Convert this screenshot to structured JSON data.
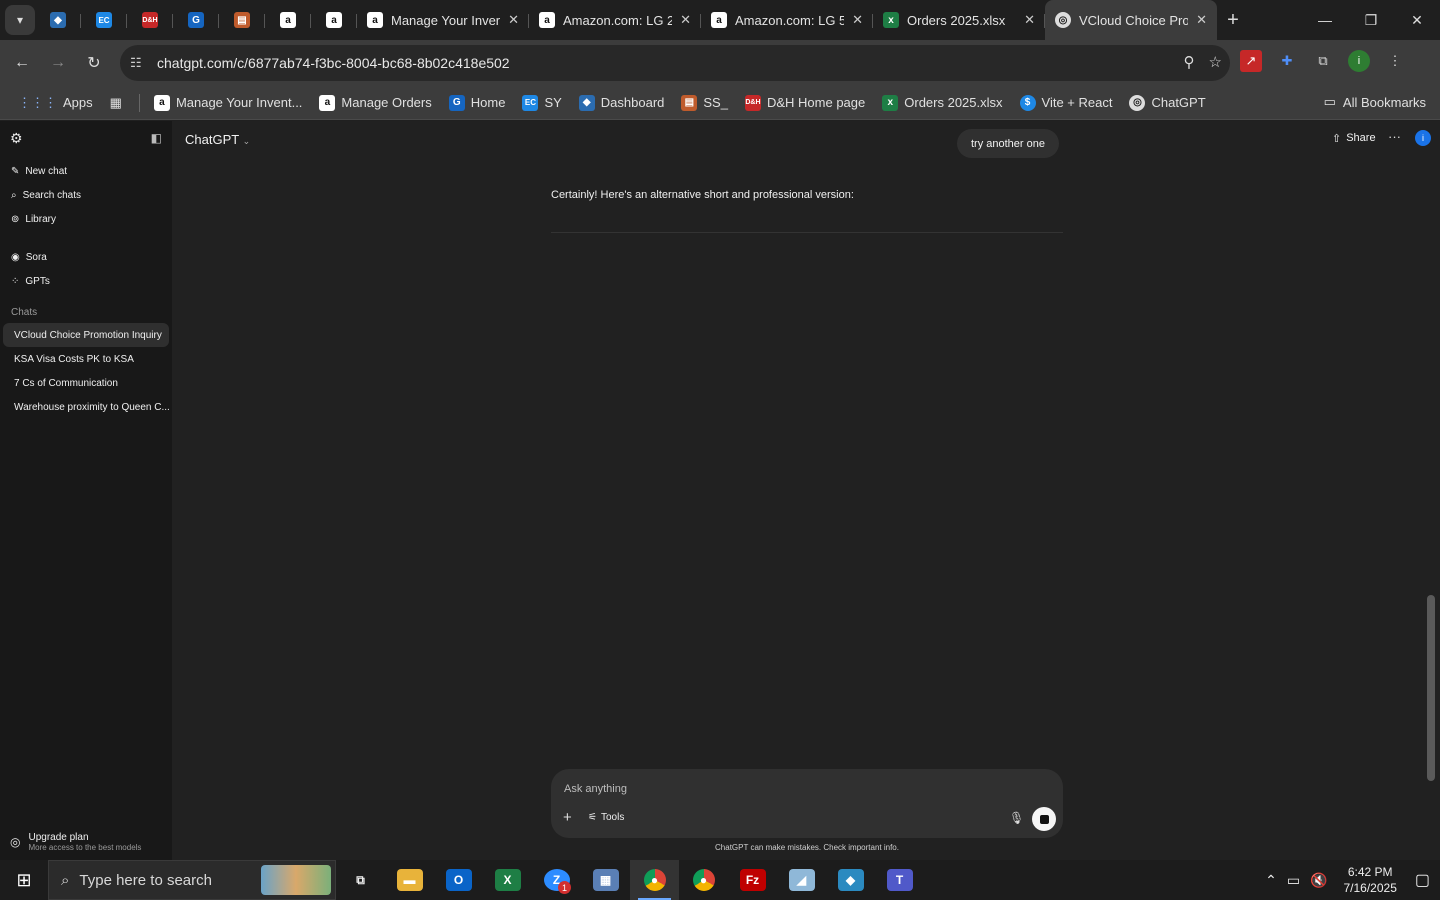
{
  "browser": {
    "tabs": [
      {
        "title": "Manage Your Inver",
        "favicon": "amazon-icon"
      },
      {
        "title": "Amazon.com: LG 2",
        "favicon": "amazon-icon"
      },
      {
        "title": "Amazon.com: LG 5",
        "favicon": "amazon-icon"
      },
      {
        "title": "Orders 2025.xlsx",
        "favicon": "excel-icon"
      },
      {
        "title": "VCloud Choice Pro",
        "favicon": "chatgpt-icon",
        "active": true
      }
    ],
    "url": "chatgpt.com/c/6877ab74-f3bc-8004-bc68-8b02c418e502",
    "bookmarks": {
      "apps_label": "Apps",
      "items": [
        "Manage Your Invent...",
        "Manage Orders",
        "Home",
        "SY",
        "Dashboard",
        "SS_",
        "D&H Home page",
        "Orders 2025.xlsx",
        "Vite + React",
        "ChatGPT"
      ],
      "all_bookmarks": "All Bookmarks"
    },
    "profile_initial": "i"
  },
  "sidebar": {
    "nav": [
      "New chat",
      "Search chats",
      "Library"
    ],
    "nav2": [
      "Sora",
      "GPTs"
    ],
    "chats_label": "Chats",
    "chats": [
      "VCloud Choice Promotion Inquiry",
      "KSA Visa Costs PK to KSA",
      "7 Cs of Communication",
      "Warehouse proximity to Queen C..."
    ],
    "upgrade_title": "Upgrade plan",
    "upgrade_sub": "More access to the best models"
  },
  "main": {
    "model": "ChatGPT",
    "share": "Share",
    "profile_initial": "i",
    "user_message": "try another  one",
    "assistant_message": "Certainly! Here's an alternative short and professional version:",
    "composer_placeholder": "Ask anything",
    "tools_label": "Tools",
    "disclaimer": "ChatGPT can make mistakes. Check important info."
  },
  "taskbar": {
    "search_placeholder": "Type here to search",
    "time": "6:42 PM",
    "date": "7/16/2025",
    "zoom_badge": "1"
  }
}
